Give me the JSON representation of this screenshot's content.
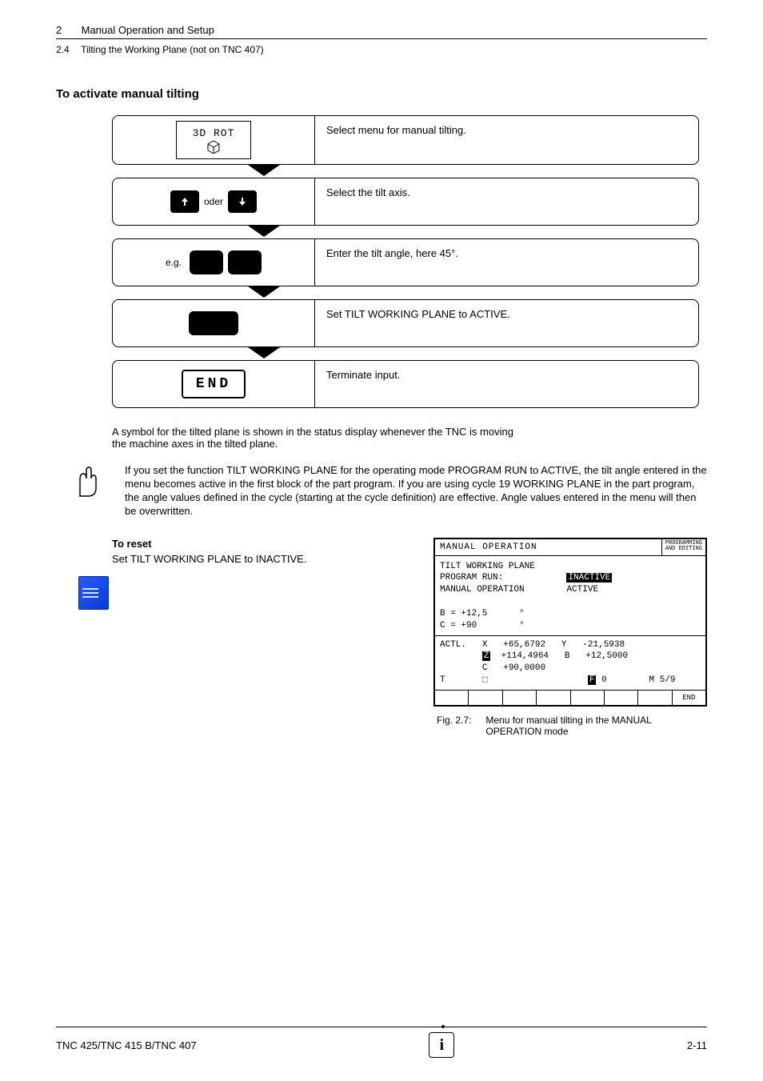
{
  "header": {
    "chapter_number": "2",
    "chapter_title": "Manual Operation and Setup",
    "section_number": "2.4",
    "section_title": "Tilting the Working Plane (not on TNC 407)"
  },
  "section": {
    "title": "To activate manual tilting"
  },
  "steps": [
    {
      "key_label": "3D ROT",
      "key_icon_name": "cube-icon",
      "desc": "Select menu for manual tilting."
    },
    {
      "prefix": "",
      "oder": "oder",
      "desc": "Select the tilt axis."
    },
    {
      "prefix": "e.g.",
      "desc": "Enter the tilt angle, here 45°."
    },
    {
      "desc": "Set TILT WORKING PLANE to ACTIVE."
    },
    {
      "key_label": "END",
      "desc": "Terminate input."
    }
  ],
  "body_note": "A symbol for the tilted plane is shown in the status display whenever the TNC is moving the machine axes in the tilted plane.",
  "important_note": "If you set the function TILT WORKING PLANE for the operating mode PROGRAM RUN to ACTIVE, the tilt angle entered in the menu becomes active in the first block of the part program. If you are using cycle 19 WORKING PLANE in the part program, the angle values defined in the cycle (starting at the cycle definition) are effective. Angle values entered in the menu will then be overwritten.",
  "reset": {
    "title": "To reset",
    "text": "Set TILT WORKING PLANE to INACTIVE."
  },
  "screen": {
    "title_main": "MANUAL OPERATION",
    "title_side_1": "PROGRAMMING",
    "title_side_2": "AND EDITING",
    "lines_heading": "TILT WORKING PLANE",
    "line_prog_run_label": "PROGRAM RUN:",
    "line_prog_run_value": "INACTIVE",
    "line_man_op_label": "MANUAL OPERATION",
    "line_man_op_value": "ACTIVE",
    "axis_b": "B = +12,5      °",
    "axis_c": "C = +90        °",
    "actl_label": "ACTL.",
    "actl_x_label": "X",
    "actl_x": "+65,6792",
    "actl_y_label": "Y",
    "actl_y": "-21,5938",
    "actl_z_label": "Z",
    "actl_z": "+114,4964",
    "actl_b_label": "B",
    "actl_b": "+12,5000",
    "actl_c_label": "C",
    "actl_c": "+90,0000",
    "t_label": "T",
    "f_label": "F",
    "f_value": "0",
    "m_label": "M",
    "m_value": "5/9",
    "soft_end": "END"
  },
  "figure": {
    "number": "Fig. 2.7:",
    "caption": "Menu for manual tilting in the MANUAL OPERATION mode"
  },
  "footer": {
    "left": "TNC 425/TNC 415 B/TNC 407",
    "right": "2-11"
  }
}
